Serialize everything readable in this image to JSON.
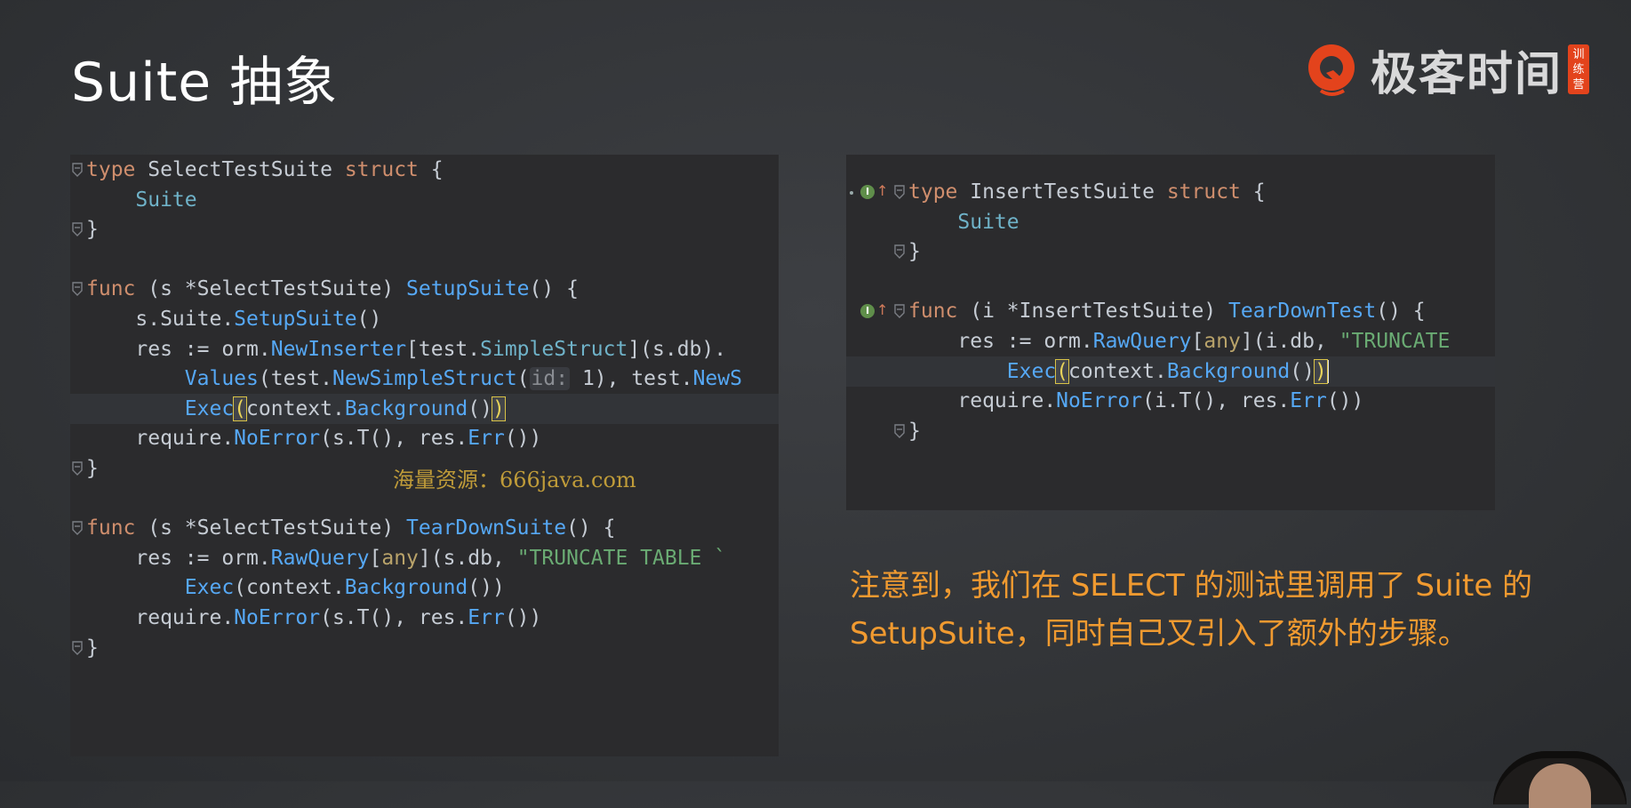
{
  "title": "Suite 抽象",
  "logo": {
    "text": "极客时间",
    "badge": "训练营",
    "brand_color": "#e3431c"
  },
  "left_code": {
    "lines": [
      [
        "type ",
        "SelectTestSuite",
        " struct {"
      ],
      [
        "    Suite"
      ],
      [
        "}"
      ],
      [
        ""
      ],
      [
        "func ",
        "(s *SelectTestSuite) ",
        "SetupSuite",
        "() {"
      ],
      [
        "    s.Suite.",
        "SetupSuite",
        "()"
      ],
      [
        "    res := orm.",
        "NewInserter",
        "[test.",
        "SimpleStruct",
        "](s.db)."
      ],
      [
        "        ",
        "Values",
        "(test.",
        "NewSimpleStruct",
        "(",
        "id:",
        " 1), test.",
        "NewS"
      ],
      [
        "        ",
        "Exec",
        "(",
        "context.",
        "Background",
        "()",
        ")"
      ],
      [
        "    require.",
        "NoError",
        "(s.T(), res.",
        "Err",
        "())"
      ],
      [
        "}"
      ],
      [
        ""
      ],
      [
        "func ",
        "(s *SelectTestSuite) ",
        "TearDownSuite",
        "() {"
      ],
      [
        "    res := orm.",
        "RawQuery",
        "[",
        "any",
        "](s.db, ",
        "\"TRUNCATE TABLE `"
      ],
      [
        "        ",
        "Exec",
        "(context.",
        "Background",
        "())"
      ],
      [
        "    require.",
        "NoError",
        "(s.T(), res.",
        "Err",
        "())"
      ],
      [
        "}"
      ]
    ]
  },
  "right_code": {
    "lines": [
      [
        "type ",
        "InsertTestSuite",
        " struct {"
      ],
      [
        "    Suite"
      ],
      [
        "}"
      ],
      [
        ""
      ],
      [
        "func ",
        "(i *InsertTestSuite) ",
        "TearDownTest",
        "() {"
      ],
      [
        "    res := orm.",
        "RawQuery",
        "[",
        "any",
        "](i.db, ",
        "\"TRUNCATE"
      ],
      [
        "        ",
        "Exec",
        "(",
        "context.",
        "Background",
        "()",
        ")"
      ],
      [
        "    require.",
        "NoError",
        "(i.T(), res.",
        "Err",
        "())"
      ],
      [
        "}"
      ]
    ],
    "gutter_icon_label": "I"
  },
  "note": {
    "line1": "注意到，我们在 SELECT 的测试里调用了 Suite 的",
    "line2": "SetupSuite，同时自己又引入了额外的步骤。"
  },
  "watermark": "海量资源：666java.com",
  "colors": {
    "background": "#333538",
    "code_bg": "#2b2b2d",
    "keyword": "#cf8e6d",
    "function": "#56a8f5",
    "string": "#6aab73",
    "note": "#f09a30"
  }
}
